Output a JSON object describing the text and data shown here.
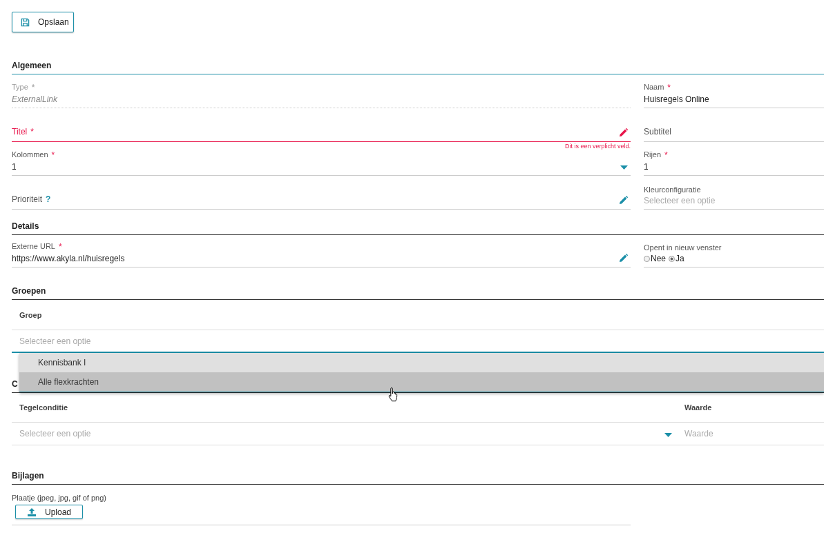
{
  "save_button": {
    "label": "Opslaan"
  },
  "general": {
    "heading": "Algemeen",
    "rows": [
      [
        {
          "label": "Type",
          "required_mark": "*",
          "value": "ExternalLink",
          "readonly": true
        },
        {
          "label": "Naam",
          "required_mark": "*",
          "value": "Huisregels Online"
        }
      ],
      [
        {
          "label": "Titel",
          "required_mark": "*",
          "invalid": true,
          "error": "Dit is een verplicht veld.",
          "editable": true
        },
        {
          "label": "Subtitel"
        }
      ],
      [
        {
          "label": "Kolommen",
          "required_mark": "*",
          "value": "1",
          "dropdown": true
        },
        {
          "label": "Rijen",
          "required_mark": "*",
          "value": "1"
        }
      ],
      [
        {
          "label": "Prioriteit",
          "help": "?",
          "editable": true
        },
        {
          "label": "Kleurconfiguratie",
          "placeholder": "Selecteer een optie"
        }
      ]
    ]
  },
  "details": {
    "heading": "Details",
    "rows": [
      [
        {
          "label": "Externe URL",
          "required_mark": "*",
          "value": "https://www.akyla.nl/huisregels",
          "editable": true
        },
        {
          "label": "Opent in nieuw venster",
          "options": [
            {
              "label": "Nee",
              "selected": false
            },
            {
              "label": "Ja",
              "selected": true
            }
          ]
        }
      ]
    ]
  },
  "groups": {
    "heading": "Groepen",
    "column": "Groep",
    "placeholder": "Selecteer een optie",
    "focused": true,
    "options": [
      {
        "label": "Kennisbank I",
        "highlighted": false
      },
      {
        "label": "Alle flexkrachten",
        "highlighted": true
      }
    ]
  },
  "conditions": {
    "heading": "C",
    "columns": [
      "Tegelconditie",
      "Waarde"
    ],
    "condition_placeholder": "Selecteer een optie",
    "value_placeholder": "Waarde"
  },
  "attachments": {
    "heading": "Bijlagen",
    "label": "Plaatje (jpeg, jpg, gif of png)",
    "upload_button": "Upload"
  }
}
